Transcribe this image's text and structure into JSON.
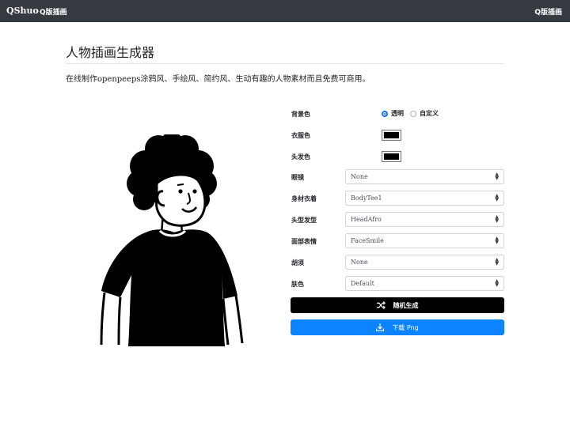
{
  "navbar": {
    "brand": "QShuo",
    "left_link": "Q版插画",
    "right_link": "Q版插画"
  },
  "page": {
    "title": "人物插画生成器",
    "subtitle": "在线制作openpeeps涂鸦风、手绘风、简约风、生动有趣的人物素材而且免费可商用。"
  },
  "form": {
    "background": {
      "label": "背景色",
      "options": [
        "透明",
        "自定义"
      ],
      "selected": "透明"
    },
    "clothes_color": {
      "label": "衣服色",
      "value": "#000000"
    },
    "hair_color": {
      "label": "头发色",
      "value": "#000000"
    },
    "glasses": {
      "label": "眼镜",
      "value": "None"
    },
    "body": {
      "label": "身材衣着",
      "value": "BodyTee1"
    },
    "head": {
      "label": "头型发型",
      "value": "HeadAfro"
    },
    "face": {
      "label": "面部表情",
      "value": "FaceSmile"
    },
    "beard": {
      "label": "胡须",
      "value": "None"
    },
    "skin": {
      "label": "肤色",
      "value": "Default"
    }
  },
  "buttons": {
    "random": "随机生成",
    "download": "下载 Png"
  },
  "icons": {
    "shuffle": "shuffle-icon",
    "download": "download-icon",
    "caret": "select-caret-icon"
  },
  "colors": {
    "navbar_bg": "#343a40",
    "primary": "#0d84ff",
    "random_btn_bg": "#000000"
  }
}
